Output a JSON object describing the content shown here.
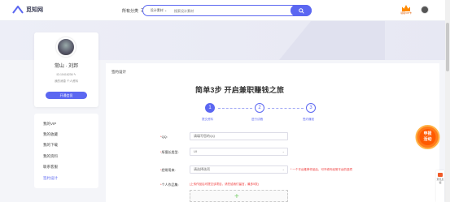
{
  "header": {
    "logo_text": "觅知网",
    "nav_label": "所有分类",
    "search_category": "设计素材",
    "search_placeholder": "搜索设计素材",
    "vip_label": "领取VIP卡"
  },
  "profile": {
    "name": "常山 · 刘邦",
    "id_line": "ID:10416236 ✎",
    "links": "我的消息  个人资料",
    "button": "开通会员"
  },
  "sidebar": {
    "items": [
      "我的VIP",
      "我的收藏",
      "我的下载",
      "我的资料",
      "联系客服",
      "签约设计"
    ]
  },
  "main": {
    "breadcrumb": "签约设计",
    "title": "简单3步   开启兼职赚钱之旅",
    "steps": [
      {
        "num": "1",
        "label": "提交资料"
      },
      {
        "num": "2",
        "label": "进行试稿"
      },
      {
        "num": "3",
        "label": "签约赚钱"
      }
    ],
    "fields": {
      "qq_label": "QQ:",
      "qq_value": "请填写您的QQ",
      "type_label": "所擅长类型:",
      "type_value": "UI",
      "platform_label": "经常用来:",
      "platform_value": "请选择选项",
      "platform_note": "* 一个平台推荐作品后，可不填写经常平台的选项",
      "works_label": "个人作品集:",
      "works_note": "(上传作品后可提交该项目，请先给我们留言，最多5张)"
    }
  },
  "float_badge": {
    "line1": "申报",
    "line2": "活动"
  },
  "side_tool": {
    "label": "意见反馈"
  },
  "colors": {
    "accent": "#5b67f1",
    "orange": "#ff8a00",
    "red": "#e33333"
  }
}
